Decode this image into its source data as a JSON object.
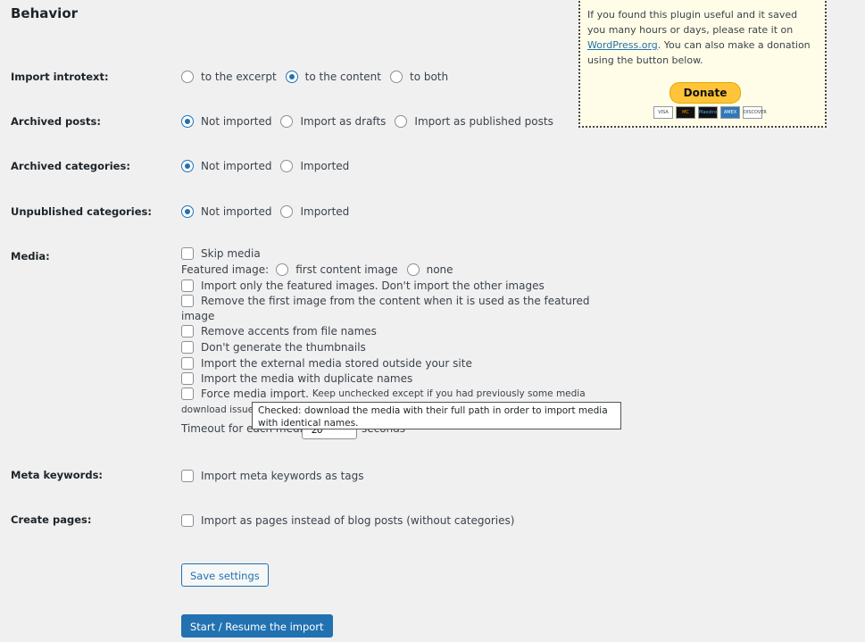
{
  "title": "Behavior",
  "introtext": {
    "label": "Import introtext:",
    "options": [
      "to the excerpt",
      "to the content",
      "to both"
    ],
    "selected": 1
  },
  "archived_posts": {
    "label": "Archived posts:",
    "options": [
      "Not imported",
      "Import as drafts",
      "Import as published posts"
    ],
    "selected": 0
  },
  "archived_categories": {
    "label": "Archived categories:",
    "options": [
      "Not imported",
      "Imported"
    ],
    "selected": 0
  },
  "unpublished_categories": {
    "label": "Unpublished categories:",
    "options": [
      "Not imported",
      "Imported"
    ],
    "selected": 0
  },
  "media": {
    "label": "Media:",
    "skip": "Skip media",
    "featured_label": "Featured image:",
    "featured_options": [
      "first content image",
      "none"
    ],
    "only_featured": "Import only the featured images. Don't import the other images",
    "remove_first_1": "Remove the first image from the content when it is used as the featured",
    "remove_first_2": "image",
    "remove_accents": "Remove accents from file names",
    "no_thumbs": "Don't generate the thumbnails",
    "external": "Import the external media stored outside your site",
    "duplicates": "Import the media with duplicate names",
    "force": "Force media import.",
    "force_hint_1": "Keep unchecked except if you had previously some media",
    "force_hint_2": "download issues.",
    "timeout_label": "Timeout for each media:",
    "timeout_value": "20",
    "timeout_unit": "seconds",
    "tooltip": "Checked: download the media with their full path in order to import media with identical names."
  },
  "meta_keywords": {
    "label": "Meta keywords:",
    "option": "Import meta keywords as tags"
  },
  "create_pages": {
    "label": "Create pages:",
    "option": "Import as pages instead of blog posts (without categories)"
  },
  "buttons": {
    "save": "Save settings",
    "start": "Start / Resume the import"
  },
  "donate": {
    "text_1": "If you found this plugin useful and it saved you many hours or days, please rate it on ",
    "link": "WordPress.org",
    "text_2": ". You can also make a donation using the button below.",
    "button": "Donate",
    "cards": [
      "VISA",
      "MC",
      "Maestro",
      "AMEX",
      "DISCOVER"
    ]
  }
}
